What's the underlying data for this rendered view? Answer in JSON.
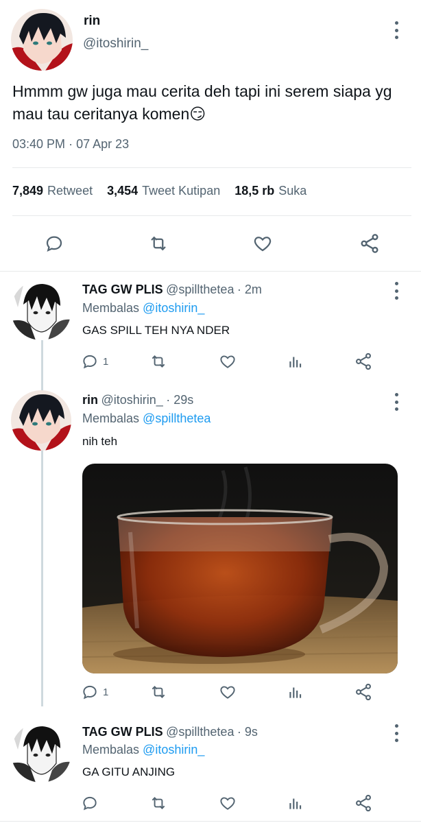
{
  "main_tweet": {
    "name": "rin",
    "handle": "@itoshirin_",
    "text": "Hmmm gw juga mau cerita deh tapi ini serem siapa yg mau tau ceritanya komen",
    "emoji": "😏",
    "timestamp": "03:40 PM",
    "date": "07 Apr 23",
    "date_sep": "·",
    "stats": [
      {
        "value": "7,849",
        "label": "Retweet"
      },
      {
        "value": "3,454",
        "label": "Tweet Kutipan"
      },
      {
        "value": "18,5 rb",
        "label": "Suka"
      }
    ]
  },
  "replies": [
    {
      "name": "TAG GW PLIS",
      "handle": "@spillthetea",
      "time": "· 2m",
      "replying_label": "Membalas",
      "replying_to": "@itoshirin_",
      "text": "GAS SPILL TEH NYA NDER",
      "reply_count": "1"
    },
    {
      "name": "rin",
      "handle": "@itoshirin_",
      "time": "· 29s",
      "replying_label": "Membalas",
      "replying_to": "@spillthetea",
      "text": "nih teh",
      "reply_count": "1",
      "has_media": true
    },
    {
      "name": "TAG GW PLIS",
      "handle": "@spillthetea",
      "time": "· 9s",
      "replying_label": "Membalas",
      "replying_to": "@itoshirin_",
      "text": "GA GITU ANJING",
      "reply_count": ""
    }
  ],
  "icons": {
    "reply": "reply-bubble-icon",
    "retweet": "retweet-icon",
    "like": "heart-icon",
    "share": "share-icon",
    "analytics": "analytics-icon",
    "more": "more-vertical-icon"
  },
  "colors": {
    "text": "#0f1419",
    "muted": "#536471",
    "link": "#1d9bf0",
    "divider": "#e7e9ea"
  }
}
